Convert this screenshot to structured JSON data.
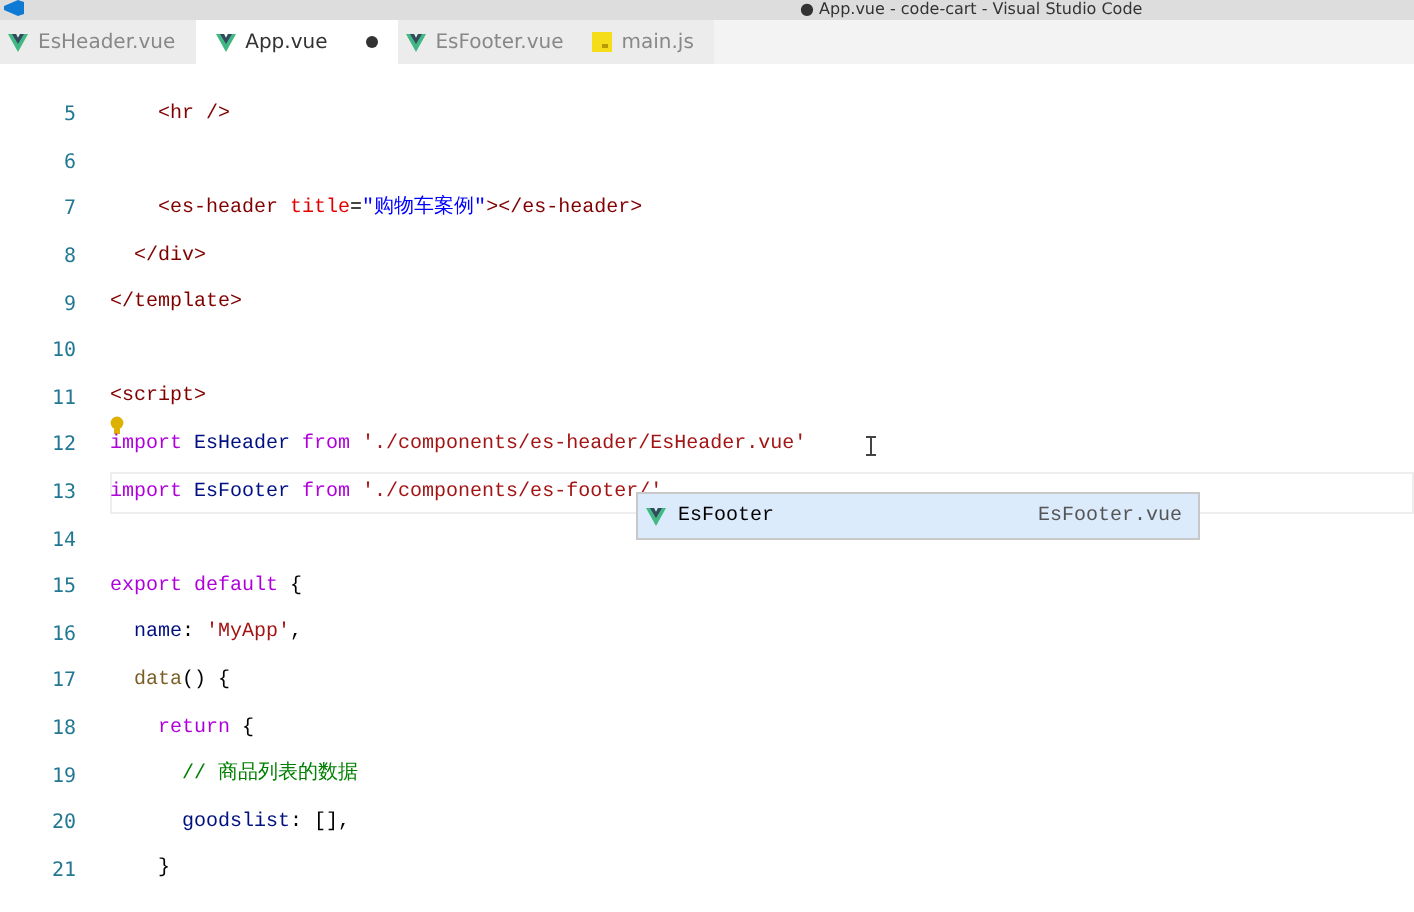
{
  "window": {
    "title": "● App.vue - code-cart - Visual Studio Code"
  },
  "tabs": [
    {
      "label": "EsHeader.vue",
      "kind": "vue",
      "selected": false,
      "modified": false
    },
    {
      "label": "App.vue",
      "kind": "vue",
      "selected": true,
      "modified": true
    },
    {
      "label": "EsFooter.vue",
      "kind": "vue",
      "selected": false,
      "modified": false
    },
    {
      "label": "main.js",
      "kind": "js",
      "selected": false,
      "modified": false
    }
  ],
  "editor": {
    "lines": [
      {
        "number": "5",
        "current": false,
        "lightbulb": false,
        "tokens": [
          {
            "kind": "tag",
            "text": "    <hr />"
          }
        ]
      },
      {
        "number": "6",
        "current": false,
        "lightbulb": false
      },
      {
        "number": "7",
        "current": false,
        "lightbulb": false,
        "tokens": [
          {
            "kind": "tag",
            "text": "    <es-header"
          },
          {
            "kind": "attr",
            "text": " title"
          },
          {
            "kind": "plain",
            "text": "="
          },
          {
            "kind": "val",
            "text": "\"购物车案例\""
          },
          {
            "kind": "tag",
            "text": "></es-header>"
          }
        ]
      },
      {
        "number": "8",
        "current": false,
        "lightbulb": false,
        "tokens": [
          {
            "kind": "tag",
            "text": "  </div>"
          }
        ]
      },
      {
        "number": "9",
        "current": false,
        "lightbulb": false,
        "tokens": [
          {
            "kind": "tag",
            "text": "</template>"
          }
        ]
      },
      {
        "number": "10",
        "current": false,
        "lightbulb": false
      },
      {
        "number": "11",
        "current": false,
        "lightbulb": false,
        "tokens": [
          {
            "kind": "tag",
            "text": "<script>"
          }
        ]
      },
      {
        "number": "12",
        "current": false,
        "lightbulb": true,
        "tokens": [
          {
            "kind": "kw",
            "text": "import"
          },
          {
            "kind": "var",
            "text": " EsHeader "
          },
          {
            "kind": "kw",
            "text": "from"
          },
          {
            "kind": "str",
            "text": " './components/es-header/EsHeader.vue'"
          }
        ]
      },
      {
        "number": "13",
        "current": true,
        "lightbulb": false,
        "tokens": [
          {
            "kind": "kw",
            "text": "import"
          },
          {
            "kind": "var",
            "text": " EsFooter "
          },
          {
            "kind": "kw",
            "text": "from"
          },
          {
            "kind": "str",
            "text": " './components/es-footer/'"
          }
        ]
      },
      {
        "number": "14",
        "current": false,
        "lightbulb": false
      },
      {
        "number": "15",
        "current": false,
        "lightbulb": false,
        "tokens": [
          {
            "kind": "kw",
            "text": "export default"
          },
          {
            "kind": "plain",
            "text": " {"
          }
        ]
      },
      {
        "number": "16",
        "current": false,
        "lightbulb": false,
        "tokens": [
          {
            "kind": "var",
            "text": "  name"
          },
          {
            "kind": "plain",
            "text": ": "
          },
          {
            "kind": "str",
            "text": "'MyApp'"
          },
          {
            "kind": "plain",
            "text": ","
          }
        ]
      },
      {
        "number": "17",
        "current": false,
        "lightbulb": false,
        "tokens": [
          {
            "kind": "fn",
            "text": "  data"
          },
          {
            "kind": "plain",
            "text": "() {"
          }
        ]
      },
      {
        "number": "18",
        "current": false,
        "lightbulb": false,
        "tokens": [
          {
            "kind": "kw",
            "text": "    return"
          },
          {
            "kind": "plain",
            "text": " {"
          }
        ]
      },
      {
        "number": "19",
        "current": false,
        "lightbulb": false,
        "tokens": [
          {
            "kind": "comment",
            "text": "      // 商品列表的数据"
          }
        ]
      },
      {
        "number": "20",
        "current": false,
        "lightbulb": false,
        "tokens": [
          {
            "kind": "var",
            "text": "      goodslist"
          },
          {
            "kind": "plain",
            "text": ": [],"
          }
        ]
      },
      {
        "number": "21",
        "current": false,
        "lightbulb": false,
        "tokens": [
          {
            "kind": "plain",
            "text": "    }"
          }
        ]
      }
    ]
  },
  "suggestion": {
    "label": "EsFooter",
    "detail": "EsFooter.vue",
    "selected": true
  }
}
